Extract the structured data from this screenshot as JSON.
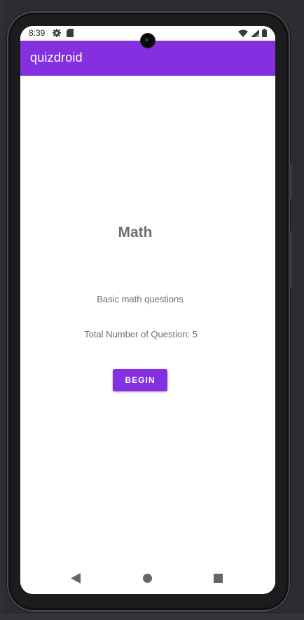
{
  "status_bar": {
    "time": "8:39",
    "left_icons": [
      "gear-icon",
      "sd-card-icon"
    ],
    "right_icons": [
      "wifi-icon",
      "cell-signal-icon",
      "battery-icon"
    ]
  },
  "app_bar": {
    "title": "quizdroid",
    "color": "#8430e0"
  },
  "quiz": {
    "title": "Math",
    "description": "Basic math questions",
    "question_count_text": "Total Number of Question: 5",
    "begin_label": "BEGIN"
  },
  "nav_bar": {
    "icons": [
      "back-icon",
      "home-icon",
      "recents-icon"
    ]
  }
}
